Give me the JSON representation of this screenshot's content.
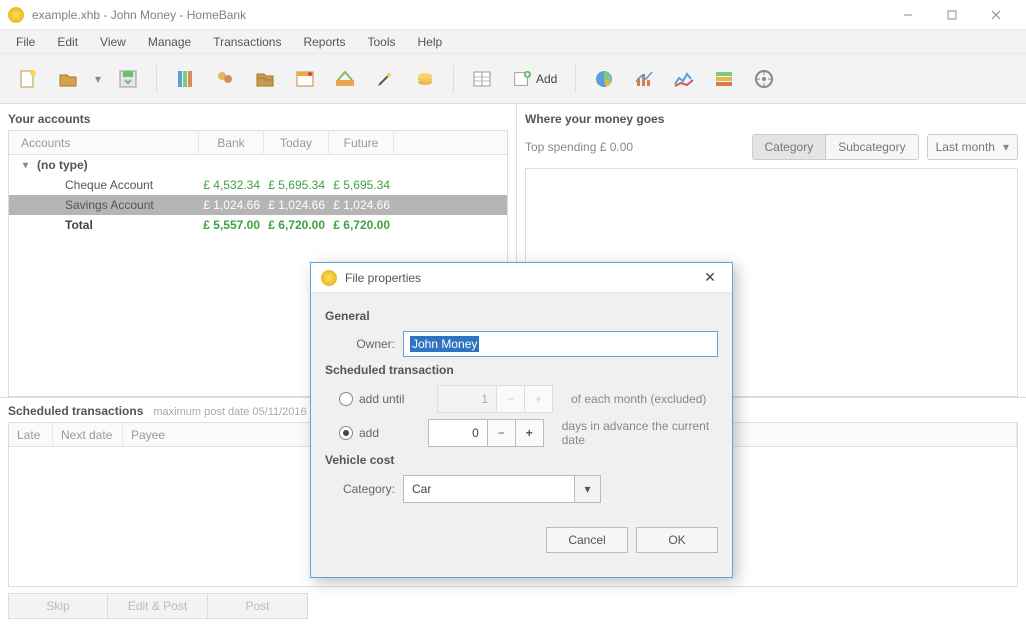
{
  "window": {
    "title": "example.xhb - John Money - HomeBank"
  },
  "menu": [
    "File",
    "Edit",
    "View",
    "Manage",
    "Transactions",
    "Reports",
    "Tools",
    "Help"
  ],
  "toolbar": {
    "add_label": "Add"
  },
  "accounts": {
    "title": "Your accounts",
    "headers": {
      "accounts": "Accounts",
      "bank": "Bank",
      "today": "Today",
      "future": "Future"
    },
    "group": "(no type)",
    "rows": [
      {
        "name": "Cheque Account",
        "bank": "£ 4,532.34",
        "today": "£ 5,695.34",
        "future": "£ 5,695.34",
        "selected": false
      },
      {
        "name": "Savings Account",
        "bank": "£ 1,024.66",
        "today": "£ 1,024.66",
        "future": "£ 1,024.66",
        "selected": true
      }
    ],
    "total": {
      "name": "Total",
      "bank": "£ 5,557.00",
      "today": "£ 6,720.00",
      "future": "£ 6,720.00"
    }
  },
  "spending": {
    "title": "Where your money goes",
    "summary": "Top spending   £ 0.00",
    "seg": {
      "category": "Category",
      "subcategory": "Subcategory"
    },
    "range": "Last month"
  },
  "scheduled": {
    "title": "Scheduled transactions",
    "sub": "maximum post date   05/11/2016",
    "headers": {
      "late": "Late",
      "next": "Next date",
      "payee": "Payee"
    },
    "buttons": {
      "skip": "Skip",
      "editpost": "Edit & Post",
      "post": "Post"
    }
  },
  "dialog": {
    "title": "File properties",
    "general": "General",
    "owner_label": "Owner:",
    "owner_value": "John Money",
    "scheduled_section": "Scheduled transaction",
    "radio_until": "add until",
    "radio_add": "add",
    "until_value": "1",
    "add_value": "0",
    "until_trail": "of each month (excluded)",
    "add_trail": "days in advance the current date",
    "vehicle_section": "Vehicle cost",
    "category_label": "Category:",
    "category_value": "Car",
    "cancel": "Cancel",
    "ok": "OK"
  }
}
